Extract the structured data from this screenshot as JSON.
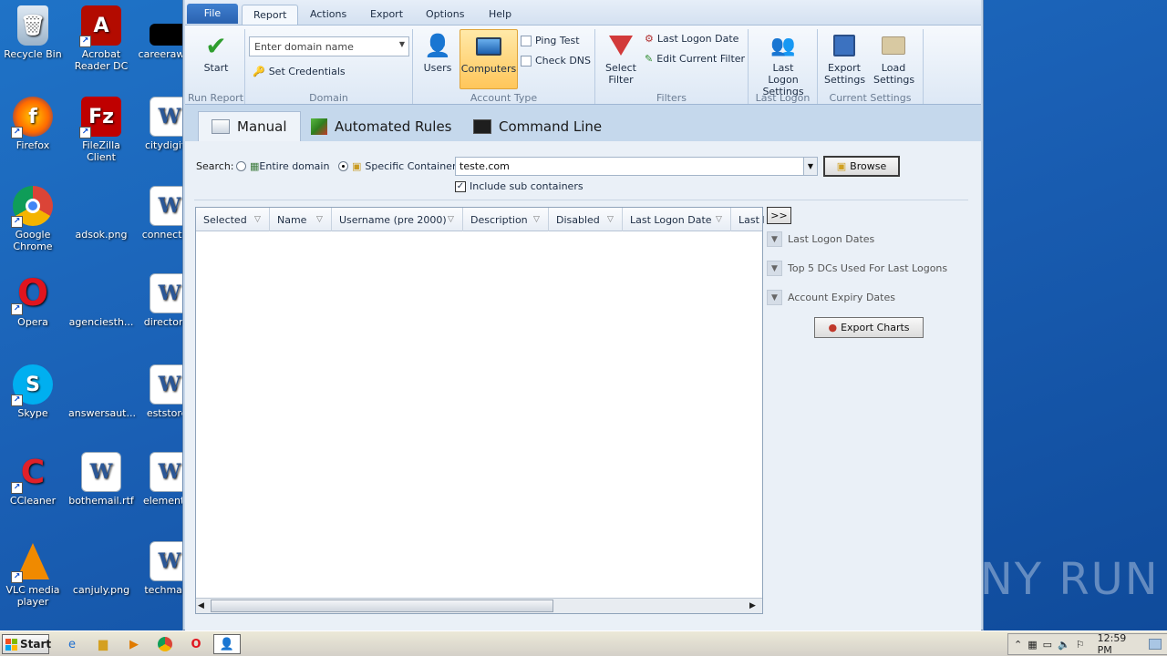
{
  "desktop": {
    "icons": [
      {
        "label": "Recycle Bin"
      },
      {
        "label": "Acrobat Reader DC"
      },
      {
        "label": "careeraward"
      },
      {
        "label": "Firefox"
      },
      {
        "label": "FileZilla Client"
      },
      {
        "label": "citydigital"
      },
      {
        "label": "Google Chrome"
      },
      {
        "label": "adsok.png"
      },
      {
        "label": "connection"
      },
      {
        "label": "Opera"
      },
      {
        "label": "agenciesth..."
      },
      {
        "label": "directoran"
      },
      {
        "label": "Skype"
      },
      {
        "label": "answersaut..."
      },
      {
        "label": "eststores"
      },
      {
        "label": "CCleaner"
      },
      {
        "label": "bothemail.rtf"
      },
      {
        "label": "elementsp"
      },
      {
        "label": "VLC media player"
      },
      {
        "label": "canjuly.png"
      },
      {
        "label": "techmana"
      }
    ],
    "watermark": "ANY RUN"
  },
  "menubar": {
    "items": [
      "File",
      "Report",
      "Actions",
      "Export",
      "Options",
      "Help"
    ],
    "active": "Report"
  },
  "ribbon": {
    "start_label": "Start",
    "run_report_group": "Run Report",
    "domain_placeholder": "Enter domain name",
    "set_credentials": "Set Credentials",
    "domain_group": "Domain",
    "users_label": "Users",
    "computers_label": "Computers",
    "ping_test": "Ping Test",
    "check_dns": "Check DNS",
    "account_type_group": "Account Type",
    "select_filter": "Select Filter",
    "last_logon_date": "Last Logon Date",
    "edit_current_filter": "Edit Current Filter",
    "filters_group": "Filters",
    "last_logon_settings": "Last Logon Settings",
    "last_logon_group": "Last Logon",
    "export_settings": "Export Settings",
    "load_settings": "Load Settings",
    "current_settings_group": "Current Settings"
  },
  "tabs": [
    "Manual",
    "Automated Rules",
    "Command Line"
  ],
  "search": {
    "label": "Search:",
    "entire_domain": "Entire domain",
    "specific_container": "Specific Container:",
    "container_value": "teste.com",
    "browse": "Browse",
    "include_sub": "Include sub containers"
  },
  "grid": {
    "columns": [
      "Selected",
      "Name",
      "Username (pre 2000)",
      "Description",
      "Disabled",
      "Last Logon Date",
      "Last L"
    ]
  },
  "side": {
    "expand": ">>",
    "items": [
      "Last Logon Dates",
      "Top 5 DCs Used For Last Logons",
      "Account Expiry Dates"
    ],
    "export_charts": "Export Charts"
  },
  "taskbar": {
    "start": "Start",
    "time": "12:59 PM"
  }
}
